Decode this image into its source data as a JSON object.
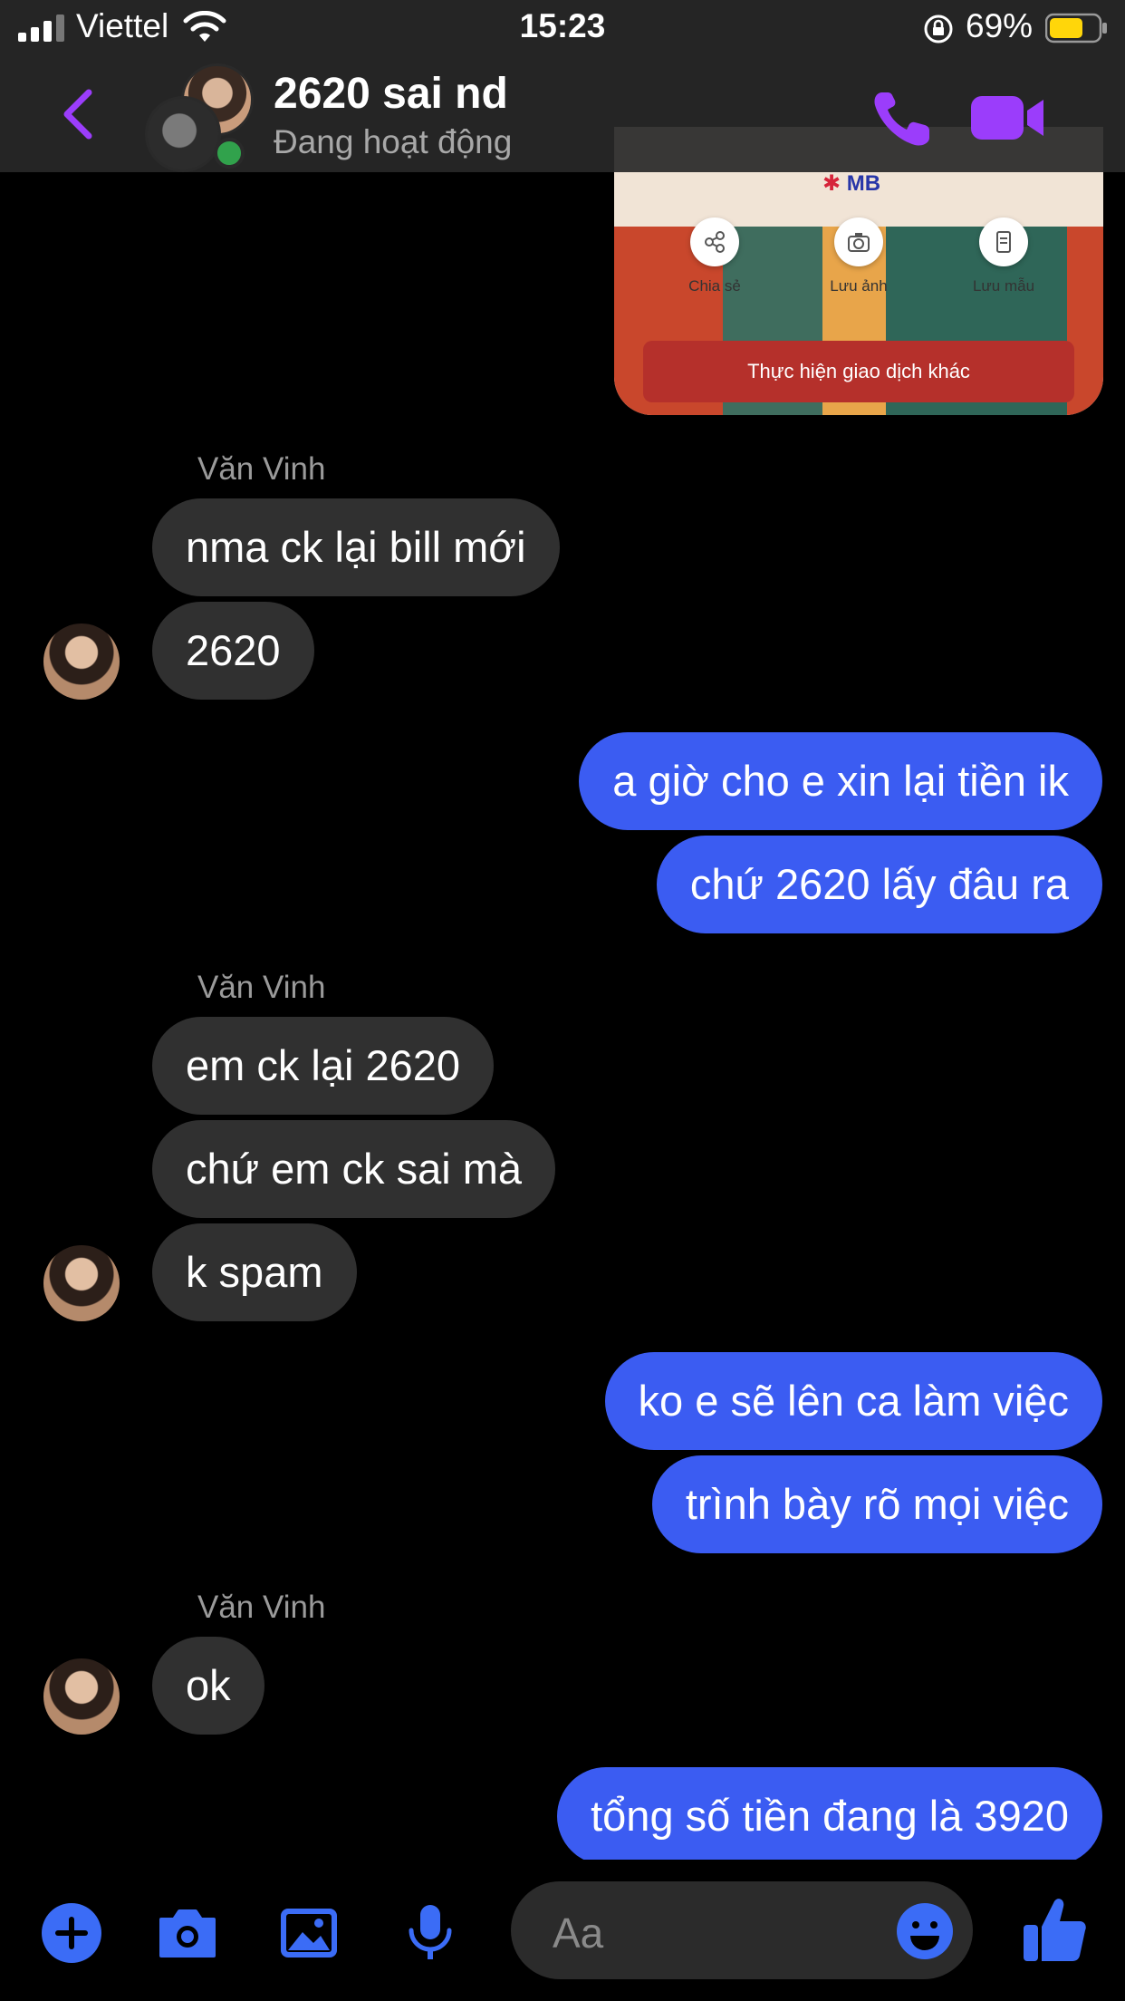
{
  "status_bar": {
    "carrier": "Viettel",
    "time": "15:23",
    "battery": "69%"
  },
  "header": {
    "title": "2620 sai nd",
    "subtitle": "Đang hoạt động"
  },
  "shared_image": {
    "logo": "MB",
    "actions": [
      "Chia sẻ",
      "Lưu ảnh",
      "Lưu mẫu"
    ],
    "button": "Thực hiện giao dịch khác"
  },
  "messages": {
    "sender_name": "Văn Vinh",
    "m1": "nma ck lại bill mới",
    "m2": "2620",
    "m3": "a giờ cho e xin lại tiền ik",
    "m4": "chứ 2620 lấy đâu ra",
    "m5": "em ck lại 2620",
    "m6": "chứ em ck sai mà",
    "m7": "k spam",
    "m8": "ko e sẽ lên ca làm việc",
    "m9": "trình bày rõ mọi việc",
    "m10": "ok",
    "m11": "tổng số tiền đang là 3920"
  },
  "composer": {
    "placeholder": "Aa"
  },
  "colors": {
    "accent": "#9b3dfb",
    "outgoing": "#3b5cf2",
    "incoming": "#303030",
    "online": "#31a24c"
  }
}
